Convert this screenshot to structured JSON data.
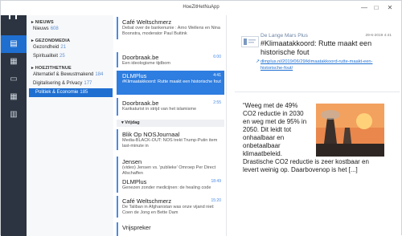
{
  "app": {
    "title": "HoeZitHetNuApp"
  },
  "window_controls": {
    "minimize": "—",
    "maximize": "□",
    "close": "✕"
  },
  "rail": {
    "logo_icon": "h-logo-icon",
    "items": [
      {
        "icon": "list-icon",
        "glyph": "▤"
      },
      {
        "icon": "film-icon",
        "glyph": "▦"
      },
      {
        "icon": "desktop-icon",
        "glyph": "▭"
      },
      {
        "icon": "calendar-icon",
        "glyph": "▦"
      },
      {
        "icon": "book-icon",
        "glyph": "▥"
      }
    ]
  },
  "nav": {
    "sections": [
      {
        "title": "NIEUWS",
        "items": [
          {
            "label": "Nieuws",
            "count": "608"
          }
        ]
      },
      {
        "title": "GEZONDMEDIA",
        "items": [
          {
            "label": "Gezondheid",
            "count": "21"
          },
          {
            "label": "Spiritualiteit",
            "count": "25"
          }
        ]
      },
      {
        "title": "HOEZITHETNUE",
        "items": [
          {
            "label": "Alternatief & Bewustmakend",
            "count": "184"
          },
          {
            "label": "Digitalisering & Privacy",
            "count": "177"
          },
          {
            "label": "Politiek & Economie",
            "count": "185"
          }
        ]
      }
    ]
  },
  "list": {
    "entries": [
      {
        "source": "Café Weltschmerz",
        "time": "",
        "snippet": "Debat over de bankenunie : Arno Wellens en Nina Boonstra, moderator Paul Buitink"
      },
      {
        "source": "Doorbraak.be",
        "time": "6:00",
        "snippet": "Een ideologisme tijdbom"
      },
      {
        "source": "DLMPlus",
        "time": "4:41",
        "snippet": "#Klimaatakkoord: Rutte maakt een historische fout"
      },
      {
        "source": "Doorbraak.be",
        "time": "2:55",
        "snippet": "Karikaturist in strijd van het islamisme"
      },
      {
        "source": "Blik Op NOSJournaal",
        "time": "",
        "snippet": "Media-BLACK-OUT: NOS trekt Trump-Putin item last-minute in"
      },
      {
        "source": "Jensen",
        "time": "",
        "snippet": "(video) Jensen vs. 'publieke' Omroep Per Direct Afschaffen"
      },
      {
        "source": "DLMPlus",
        "time": "18:49",
        "snippet": "Genezen zonder medicijnen: de healing code"
      },
      {
        "source": "Café Weltschmerz",
        "time": "15:20",
        "snippet": "De Taliban in Afghanistan was onze vijand niet: Coen de Jong en Bette Dam"
      },
      {
        "source": "Vrijspreker",
        "time": "",
        "snippet": ""
      }
    ],
    "day_separator": "Vrijdag"
  },
  "detail": {
    "feed_name": "De Lange Mars Plus",
    "date": "29-6-2019 4:41",
    "headline": "#Klimaatakkoord: Rutte maakt een historische fout",
    "link": "dlmplus.nl/2019/06/29/klimaatakkoord-rutte-maakt-een-historische-fout/",
    "body": "“Weeg met de 49% CO2 reductie in 2030 en weg met de 95% in 2050. Dit leidt tot onhaalbaar en onbetaalbaar klimaatbeleid. Drastische CO2 reductie is zeer kostbaar en levert weinig op. Daarbovenop is het [...]"
  },
  "colors": {
    "accent": "#1f6fd1",
    "rail": "#2b3440",
    "nav_bg": "#f7f8fa"
  }
}
